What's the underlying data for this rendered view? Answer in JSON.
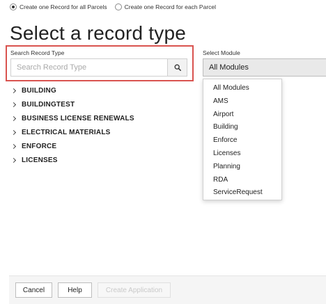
{
  "parcel_options": [
    {
      "label": "Create one Record for all Parcels",
      "checked": true
    },
    {
      "label": "Create one Record for each Parcel",
      "checked": false
    }
  ],
  "title": "Select a record type",
  "search": {
    "label": "Search Record Type",
    "placeholder": "Search Record Type",
    "value": "",
    "button_icon": "search-icon"
  },
  "module": {
    "label": "Select Module",
    "selected": "All Modules",
    "options": [
      "All Modules",
      "AMS",
      "Airport",
      "Building",
      "Enforce",
      "Licenses",
      "Planning",
      "RDA",
      "ServiceRequest"
    ]
  },
  "record_types": [
    "BUILDING",
    "BUILDINGTEST",
    "BUSINESS LICENSE RENEWALS",
    "ELECTRICAL MATERIALS",
    "ENFORCE",
    "LICENSES"
  ],
  "buttons": {
    "cancel": "Cancel",
    "help": "Help",
    "create": "Create Application"
  },
  "colors": {
    "highlight": "#d9534f",
    "disabled_text": "#c9c9c9"
  }
}
